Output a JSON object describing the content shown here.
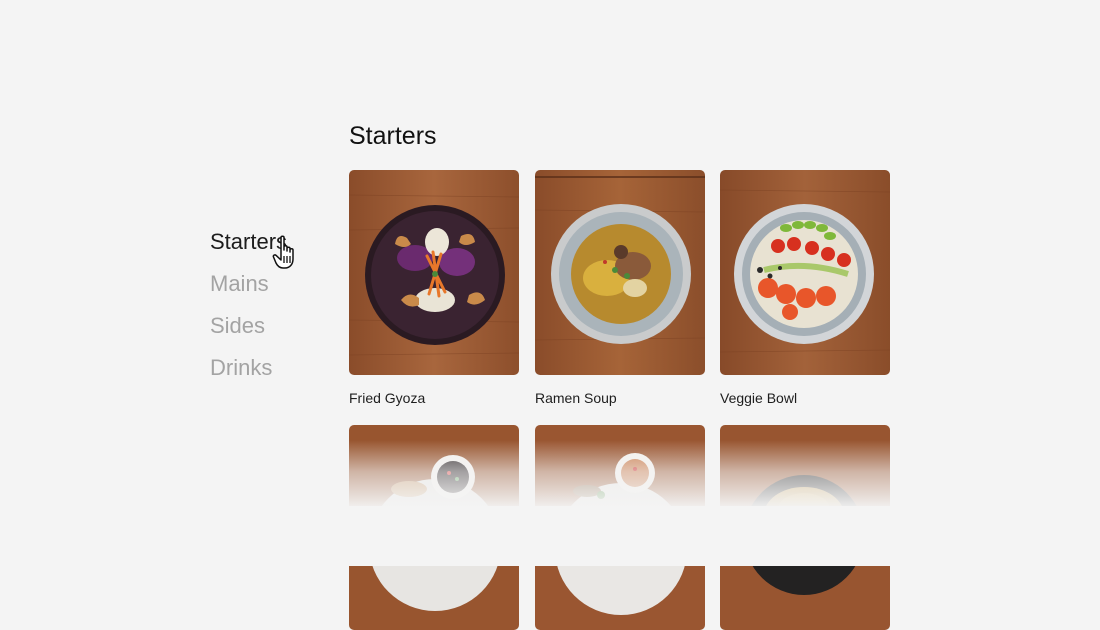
{
  "nav": {
    "items": [
      {
        "label": "Starters",
        "active": true
      },
      {
        "label": "Mains",
        "active": false
      },
      {
        "label": "Sides",
        "active": false
      },
      {
        "label": "Drinks",
        "active": false
      }
    ]
  },
  "section": {
    "title": "Starters"
  },
  "cards": [
    {
      "name": "Fried Gyoza",
      "image": "fried-gyoza-photo"
    },
    {
      "name": "Ramen Soup",
      "image": "ramen-soup-photo"
    },
    {
      "name": "Veggie Bowl",
      "image": "veggie-bowl-photo"
    },
    {
      "name": "",
      "image": "dumplings-dip-photo"
    },
    {
      "name": "",
      "image": "spring-rolls-dip-photo"
    },
    {
      "name": "",
      "image": "noodle-plate-photo"
    }
  ],
  "cursor": "hand-pointer-icon",
  "colors": {
    "background": "#f4f4f4",
    "active_nav": "#1c1c1c",
    "inactive_nav": "#a3a3a3",
    "wood": "#9a5a33"
  }
}
